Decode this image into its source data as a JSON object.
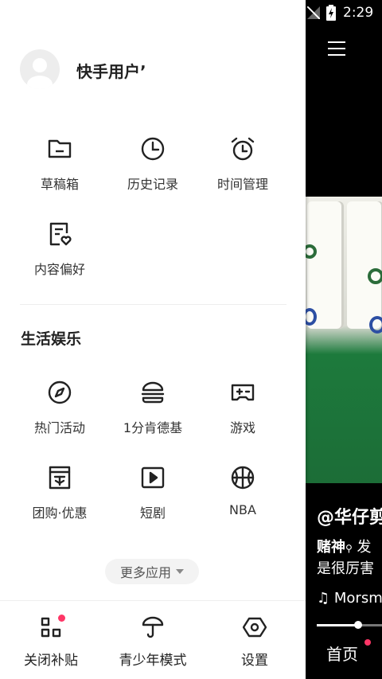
{
  "status_bar": {
    "time": "2:29"
  },
  "drawer": {
    "username": "快手用户ʼ",
    "top_items": [
      {
        "label": "草稿箱",
        "icon": "folder-icon"
      },
      {
        "label": "历史记录",
        "icon": "clock-icon"
      },
      {
        "label": "时间管理",
        "icon": "alarm-clock-icon"
      },
      {
        "label": "内容偏好",
        "icon": "content-preference-icon"
      }
    ],
    "section_title": "生活娱乐",
    "section_items": [
      {
        "label": "热门活动",
        "icon": "compass-icon"
      },
      {
        "label": "1分肯德基",
        "icon": "burger-icon"
      },
      {
        "label": "游戏",
        "icon": "gamepad-icon"
      },
      {
        "label": "团购·优惠",
        "icon": "coupon-icon"
      },
      {
        "label": "短剧",
        "icon": "play-icon"
      },
      {
        "label": "NBA",
        "icon": "basketball-icon"
      }
    ],
    "more_label": "更多应用",
    "bottom_items": [
      {
        "label": "关闭补贴",
        "icon": "subsidy-icon"
      },
      {
        "label": "青少年模式",
        "icon": "umbrella-icon"
      },
      {
        "label": "设置",
        "icon": "settings-icon"
      }
    ]
  },
  "background_app": {
    "author": "@华仔剪",
    "caption_line1": "赌神",
    "caption_line1_rest": "发",
    "caption_line2": "是很厉害",
    "music": "Morsm",
    "progress": 0.65,
    "home_tab": "首页"
  },
  "colors": {
    "accent_red": "#fe3666"
  }
}
